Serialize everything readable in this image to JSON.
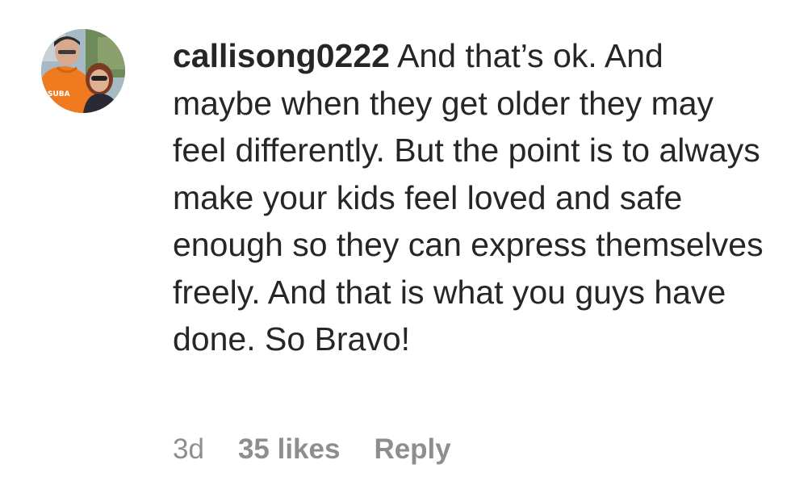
{
  "comment": {
    "username": "callisong0222",
    "text": "And that’s ok. And maybe when they get older they may feel differently. But the point is to always make your kids feel loved and safe enough so they can express themselves freely. And that is what you guys have done. So Bravo!",
    "time": "3d",
    "likes": "35 likes",
    "reply_label": "Reply",
    "avatar_shirt_text": "SUBA"
  },
  "colors": {
    "text": "#262626",
    "meta": "#8e8e8e",
    "background": "#ffffff"
  }
}
